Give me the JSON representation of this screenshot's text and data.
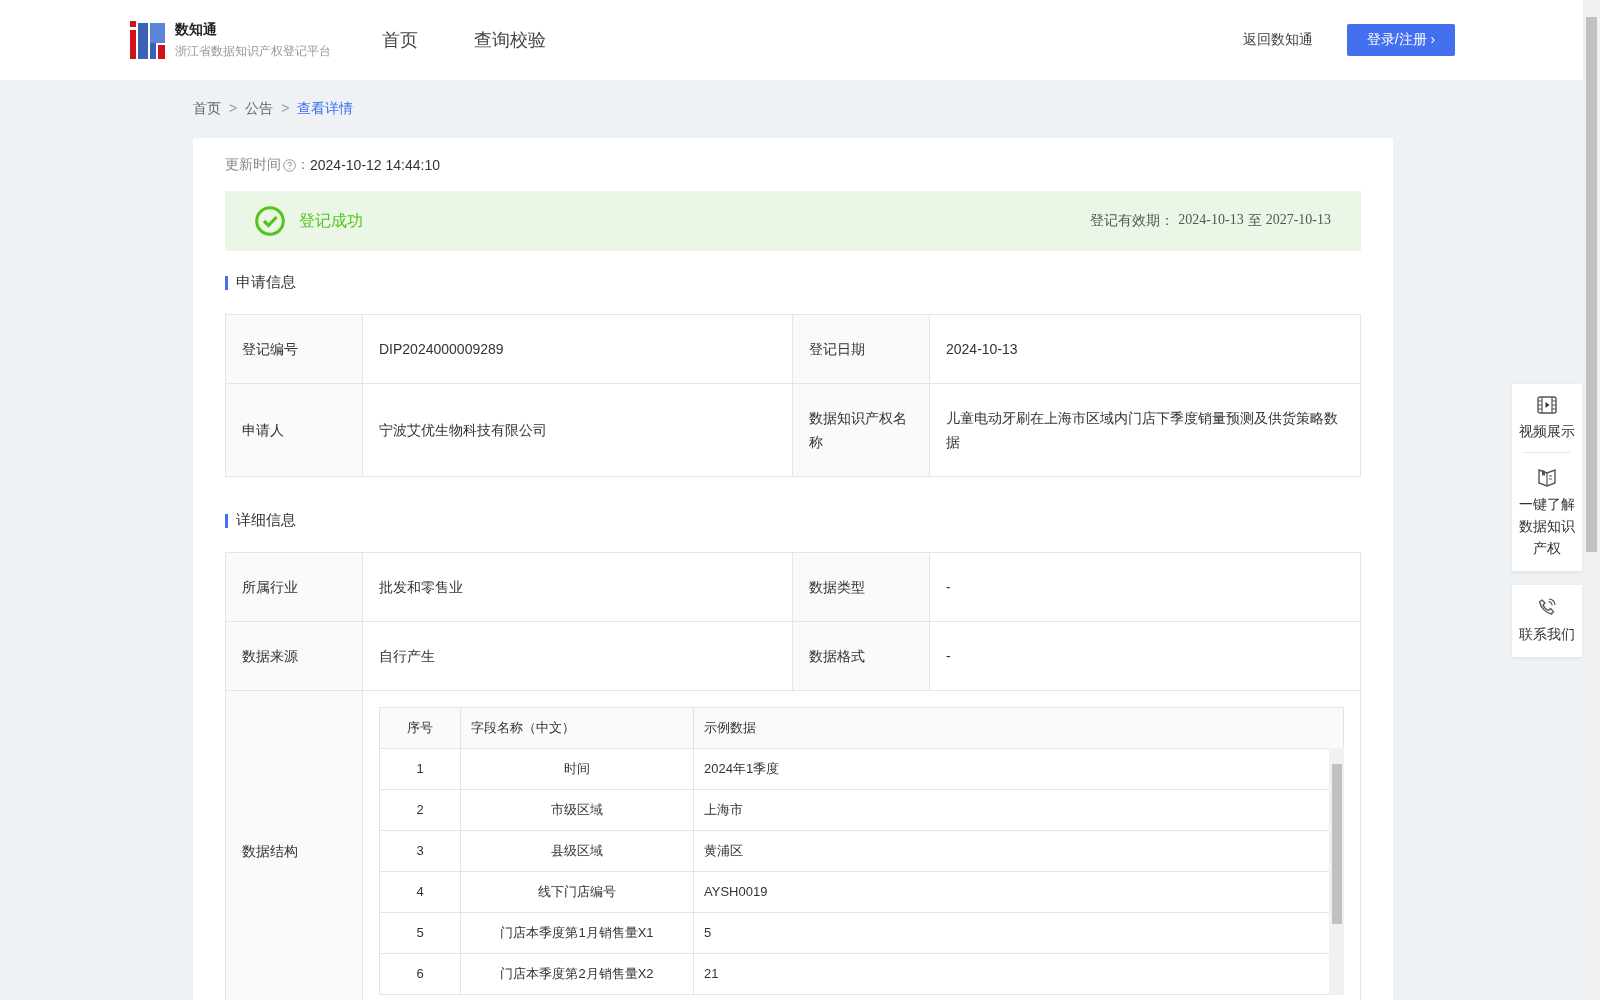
{
  "header": {
    "logo_title": "数知通",
    "logo_subtitle": "浙江省数据知识产权登记平台",
    "nav": [
      {
        "label": "首页"
      },
      {
        "label": "查询校验"
      }
    ],
    "back_link": "返回数知通",
    "login_button": "登录/注册",
    "login_caret": "›"
  },
  "breadcrumb": [
    {
      "label": "首页",
      "current": false
    },
    {
      "label": "公告",
      "current": false
    },
    {
      "label": "查看详情",
      "current": true
    }
  ],
  "breadcrumb_separator": ">",
  "update": {
    "label": "更新时间",
    "colon": "：",
    "value": "2024-10-12 14:44:10"
  },
  "status": {
    "text": "登记成功",
    "validity_label": "登记有效期：",
    "validity_start": "2024-10-13",
    "validity_to": "至",
    "validity_end": "2027-10-13"
  },
  "application": {
    "title": "申请信息",
    "rows": [
      [
        {
          "label": "登记编号",
          "value": "DIP2024000009289"
        },
        {
          "label": "登记日期",
          "value": "2024-10-13"
        }
      ],
      [
        {
          "label": "申请人",
          "value": "宁波艾优生物科技有限公司"
        },
        {
          "label": "数据知识产权名称",
          "value": "儿童电动牙刷在上海市区域内门店下季度销量预测及供货策略数据"
        }
      ]
    ]
  },
  "details": {
    "title": "详细信息",
    "rows": [
      [
        {
          "label": "所属行业",
          "value": "批发和零售业"
        },
        {
          "label": "数据类型",
          "value": "-"
        }
      ],
      [
        {
          "label": "数据来源",
          "value": "自行产生"
        },
        {
          "label": "数据格式",
          "value": "-"
        }
      ]
    ],
    "structure_label": "数据结构",
    "structure": {
      "columns": [
        "序号",
        "字段名称（中文）",
        "示例数据"
      ],
      "rows": [
        [
          "1",
          "时间",
          "2024年1季度"
        ],
        [
          "2",
          "市级区域",
          "上海市"
        ],
        [
          "3",
          "县级区域",
          "黄浦区"
        ],
        [
          "4",
          "线下门店编号",
          "AYSH0019"
        ],
        [
          "5",
          "门店本季度第1月销售量X1",
          "5"
        ],
        [
          "6",
          "门店本季度第2月销售量X2",
          "21"
        ]
      ]
    }
  },
  "side_panel": [
    {
      "kind": "video",
      "label": "视频展示"
    },
    {
      "kind": "book",
      "label": "一键了解数据知识产权"
    },
    {
      "kind": "phone",
      "label": "联系我们"
    }
  ]
}
